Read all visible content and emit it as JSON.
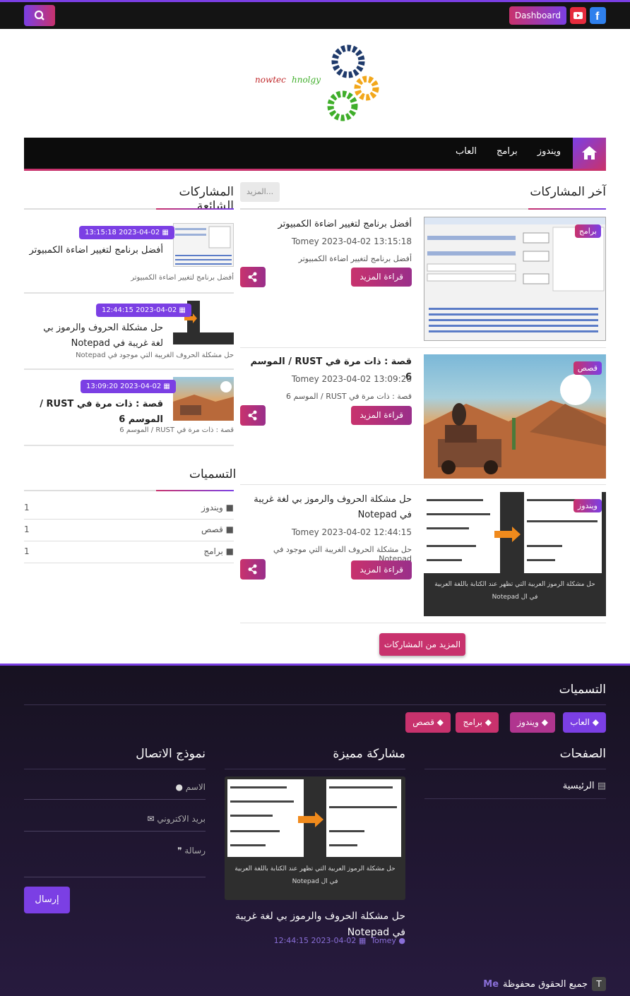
{
  "topbar": {
    "dashboard_label": "Dashboard"
  },
  "nav": {
    "items": [
      "ويندوز",
      "برامج",
      "العاب"
    ]
  },
  "logo": {
    "text": "nowtec hnolgy"
  },
  "latest": {
    "title": "آخر المشاركات",
    "more_label": "المزيد..."
  },
  "posts": [
    {
      "badge": "برامج",
      "title": "أفضل برنامج لتغيير اضاءة الكمبيوتر",
      "meta": "13:15:18 2023-04-02 Tomey",
      "excerpt": "أفضل برنامج لتغيير اضاءة الكمبيوتر",
      "read_more": "قراءة المزيد"
    },
    {
      "badge": "قصص",
      "title": "قصة : ذات مرة في RUST / الموسم 6",
      "meta": "13:09:20 2023-04-02 Tomey",
      "excerpt": "قصة : ذات مرة في RUST / الموسم 6",
      "read_more": "قراءة المزيد"
    },
    {
      "badge": "ويندوز",
      "title": "حل مشكلة الحروف والرموز بي لغة غريبة في Notepad",
      "meta": "12:44:15 2023-04-02 Tomey",
      "excerpt": "حل مشكلة الحروف الغريبة التي موجود في Notepad",
      "read_more": "قراءة المزيد"
    }
  ],
  "more_posts_label": "المزيد من المشاركات",
  "popular": {
    "title": "المشاركات الشائعة",
    "items": [
      {
        "date": "13:15:18 2023-04-02",
        "title": "أفضل برنامج لتغيير اضاءة الكمبيوتر",
        "excerpt": "أفضل برنامج لتغيير اضاءة الكمبيوتر"
      },
      {
        "date": "12:44:15 2023-04-02",
        "title": "حل مشكلة الحروف والرموز بي لغة غريبة في Notepad",
        "excerpt": "حل مشكلة الحروف الغريبة التي موجود في Notepad"
      },
      {
        "date": "13:09:20 2023-04-02",
        "title": "قصة : ذات مرة في RUST / الموسم 6",
        "excerpt": "قصة : ذات مرة في RUST / الموسم 6"
      }
    ]
  },
  "labels": {
    "title": "التسميات",
    "items": [
      {
        "name": "ويندوز",
        "count": "1"
      },
      {
        "name": "قصص",
        "count": "1"
      },
      {
        "name": "برامج",
        "count": "1"
      }
    ]
  },
  "image_captions": {
    "notepad_line1": "حل مشكلة الرموز العربية التي تظهر عند الكتابة باللغة العربية",
    "notepad_line2": "في ال Notepad"
  },
  "footer": {
    "labels_title": "التسميات",
    "tags": [
      "العاب",
      "ويندوز",
      "برامج",
      "قصص"
    ],
    "pages_title": "الصفحات",
    "pages": [
      "الرئيسية"
    ],
    "featured_title": "مشاركة مميزة",
    "featured": {
      "title": "حل مشكلة الحروف والرموز بي لغة غريبة في Notepad",
      "author": "Tomey",
      "date": "12:44:15 2023-04-02"
    },
    "contact_title": "نموذج الاتصال",
    "contact": {
      "name_ph": "الاسم",
      "email_ph": "بريد الاكتروني",
      "message_ph": "رسالة",
      "send_label": "إرسال"
    },
    "copyright": "جميع الحقوق محفوظة",
    "brand": "Me",
    "brand_icon": "T"
  },
  "colors": {
    "accent_purple": "#7b3fe4",
    "accent_pink": "#c8326d",
    "dark": "#141414"
  }
}
